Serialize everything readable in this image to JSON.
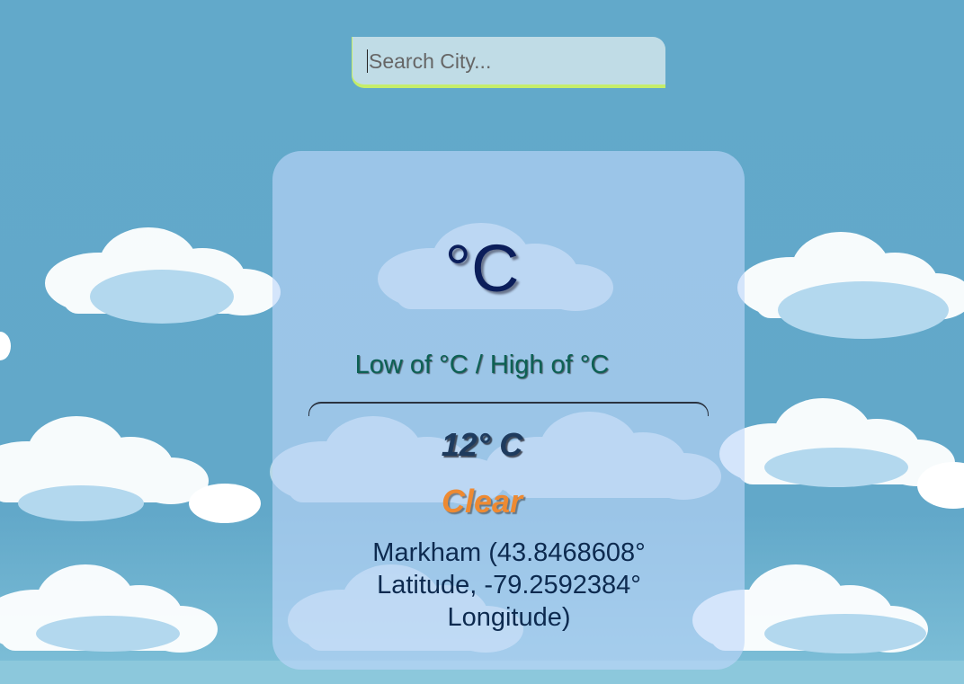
{
  "search": {
    "placeholder": "Search City...",
    "value": ""
  },
  "weather": {
    "temperature": "°C",
    "range": "Low of °C / High of °C",
    "current_temp": "12° C",
    "condition": "Clear",
    "location": "Markham (43.8468608° Latitude, -79.2592384° Longitude)"
  },
  "colors": {
    "sky": "#62a9ca",
    "card": "#bed7fa",
    "accent_border": "#c5ed6a",
    "temperature": "#0b1e5b",
    "range": "#0d6154",
    "condition": "#ee8a32"
  }
}
